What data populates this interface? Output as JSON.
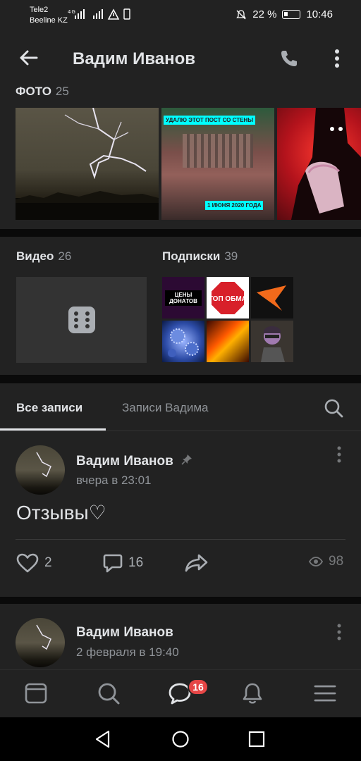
{
  "status_bar": {
    "carrier_1": "Tele2",
    "carrier_2": "Beeline KZ",
    "network": "4G",
    "battery": "22 %",
    "time": "10:46"
  },
  "header": {
    "title": "Вадим Иванов",
    "back_icon": "arrow-left-icon",
    "call_icon": "phone-icon",
    "menu_icon": "more-vertical-icon"
  },
  "photos": {
    "label": "ФОТО",
    "count": "25",
    "items": [
      {
        "caption": ""
      },
      {
        "caption_top": "УДАЛЮ ЭТОТ ПОСТ СО СТЕНЫ",
        "caption_bottom": "1 ИЮНЯ 2020 ГОДА"
      },
      {
        "caption": ""
      }
    ]
  },
  "videos": {
    "label": "Видео",
    "count": "26"
  },
  "subscriptions": {
    "label": "Подписки",
    "count": "39",
    "items": [
      {
        "text": "ЦЕНЫ ДОНАТОВ"
      },
      {
        "text": "СТОП ОБМАН"
      },
      {
        "text": ""
      },
      {
        "text": ""
      },
      {
        "text": ""
      },
      {
        "text": ""
      }
    ]
  },
  "wall": {
    "tabs": [
      {
        "label": "Все записи",
        "active": true
      },
      {
        "label": "Записи Вадима",
        "active": false
      }
    ],
    "search_icon": "search-icon"
  },
  "posts": [
    {
      "author": "Вадим Иванов",
      "pinned": true,
      "date": "вчера в 23:01",
      "text": "Отзывы♡",
      "likes": "2",
      "comments": "16",
      "views": "98"
    },
    {
      "author": "Вадим Иванов",
      "pinned": false,
      "date": "2 февраля в 19:40"
    }
  ],
  "bottom_nav": {
    "items": [
      "newsfeed-icon",
      "search-icon",
      "messages-icon",
      "notifications-icon",
      "menu-icon"
    ],
    "messages_badge": "16"
  },
  "colors": {
    "background": "#0a0a0a",
    "card": "#222222",
    "text_primary": "#e1e3e6",
    "text_secondary": "#909499",
    "badge": "#e64646"
  }
}
